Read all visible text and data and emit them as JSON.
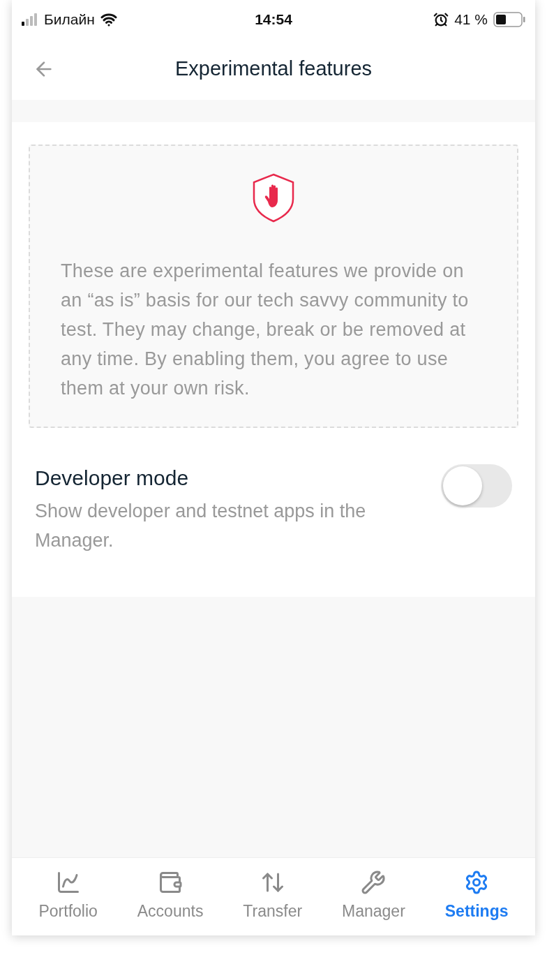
{
  "status_bar": {
    "carrier": "Билайн",
    "time": "14:54",
    "battery": "41 %"
  },
  "header": {
    "title": "Experimental features"
  },
  "notice": {
    "text": "These are experimental features we provide on an “as is” basis for our tech savvy community to test. They may change, break or be removed at any time. By enabling them, you agree to use them at your own risk."
  },
  "settings": [
    {
      "title": "Developer mode",
      "description": "Show developer and testnet apps in the Manager.",
      "on": false
    }
  ],
  "tab_bar": [
    {
      "label": "Portfolio",
      "selected": false
    },
    {
      "label": "Accounts",
      "selected": false
    },
    {
      "label": "Transfer",
      "selected": false
    },
    {
      "label": "Manager",
      "selected": false
    },
    {
      "label": "Settings",
      "selected": true
    }
  ]
}
